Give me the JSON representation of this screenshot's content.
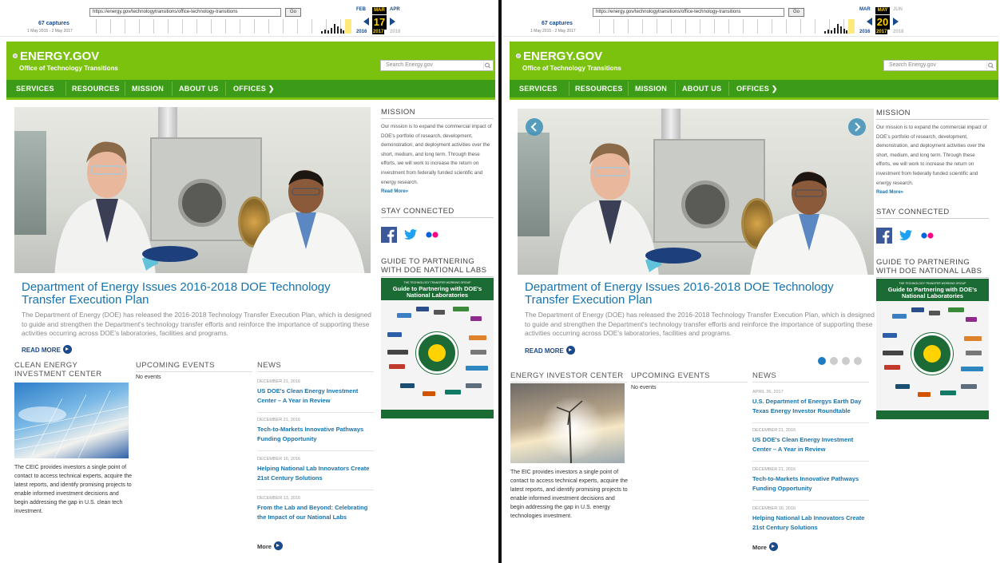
{
  "panels": [
    {
      "wayback": {
        "url": "https://energy.gov/technologytransitions/office-technology-transitions",
        "go": "Go",
        "captures": "67 captures",
        "range": "1 May 2015 - 2 May 2017",
        "prev_month": "FEB",
        "cur_month": "MAR",
        "next_month": "APR",
        "day": "17",
        "prev_year": "2016",
        "cur_year": "2017",
        "next_year": "2018"
      },
      "site": {
        "logo": "ENERGY.GOV",
        "office": "Office of Technology Transitions",
        "search_placeholder": "Search Energy.gov",
        "nav": [
          "SERVICES",
          "RESOURCES",
          "MISSION",
          "ABOUT US",
          "OFFICES ❯"
        ]
      },
      "feature": {
        "title": "Department of Energy Issues 2016-2018 DOE Technology Transfer Execution Plan",
        "body": "The Department of Energy (DOE) has released the 2016-2018 Technology Transfer Execution Plan, which is designed to guide and strengthen the Department's technology transfer efforts and reinforce the importance of supporting these activities occurring across DOE's laboratories, facilities and programs.",
        "read_more": "READ MORE"
      },
      "center": {
        "heading": "CLEAN ENERGY INVESTMENT CENTER",
        "text": "The CEIC provides investors a single point of contact to access technical experts, acquire the latest reports, and identify promising projects to enable informed investment decisions and begin addressing the gap in U.S. clean tech investment."
      },
      "events": {
        "heading": "UPCOMING EVENTS",
        "empty": "No events"
      },
      "news": {
        "heading": "NEWS",
        "items": [
          {
            "date": "DECEMBER 21, 2016",
            "title": "US DOE's Clean Energy Investment Center – A Year in Review"
          },
          {
            "date": "DECEMBER 21, 2016",
            "title": "Tech-to-Markets Innovative Pathways Funding Opportunity"
          },
          {
            "date": "DECEMBER 16, 2016",
            "title": "Helping National Lab Innovators Create 21st Century Solutions"
          },
          {
            "date": "DECEMBER 13, 2016",
            "title": "From the Lab and Beyond: Celebrating the Impact of our National Labs"
          }
        ],
        "more": "More"
      },
      "sidebar": {
        "mission_heading": "MISSION",
        "mission_text": "Our mission is to expand the commercial impact of DOE's portfolio of research, development, demonstration, and deployment activities over the short, medium, and long term. Through these efforts, we will work to increase the return on investment from federally funded scientific and energy research.",
        "read_more": "Read More»",
        "stay_heading": "STAY CONNECTED",
        "guide_heading": "GUIDE TO PARTNERING WITH DOE NATIONAL LABS",
        "guide_image_top": "THE TECHNOLOGY TRANSFER WORKING GROUP",
        "guide_image_title": "Guide to Partnering with DOE's National Laboratories"
      }
    },
    {
      "wayback": {
        "url": "https://energy.gov/technologytransitions/office-technology-transitions",
        "go": "Go",
        "captures": "67 captures",
        "range": "1 May 2015 - 2 May 2017",
        "prev_month": "MAR",
        "cur_month": "MAY",
        "next_month": "JUN",
        "day": "20",
        "prev_year": "2016",
        "cur_year": "2017",
        "next_year": "2018"
      },
      "site": {
        "logo": "ENERGY.GOV",
        "office": "Office of Technology Transitions",
        "search_placeholder": "Search Energy.gov",
        "nav": [
          "SERVICES",
          "RESOURCES",
          "MISSION",
          "ABOUT US",
          "OFFICES ❯"
        ]
      },
      "feature": {
        "title": "Department of Energy Issues 2016-2018 DOE Technology Transfer Execution Plan",
        "body": "The Department of Energy (DOE) has released the 2016-2018 Technology Transfer Execution Plan, which is designed to guide and strengthen the Department's technology transfer efforts and reinforce the importance of supporting these activities occurring across DOE's laboratories, facilities and programs.",
        "read_more": "READ MORE"
      },
      "center": {
        "heading": "ENERGY INVESTOR CENTER",
        "text": "The EIC provides investors a single point of contact to access technical experts, acquire the latest reports, and identify promising projects to enable informed investment decisions and begin addressing the gap in U.S. energy technologies investment."
      },
      "events": {
        "heading": "UPCOMING EVENTS",
        "empty": "No events"
      },
      "news": {
        "heading": "NEWS",
        "items": [
          {
            "date": "APRIL 26, 2017",
            "title": "U.S. Department of Energys Earth Day Texas Energy Investor Roundtable"
          },
          {
            "date": "DECEMBER 21, 2016",
            "title": "US DOE's Clean Energy Investment Center – A Year in Review"
          },
          {
            "date": "DECEMBER 21, 2016",
            "title": "Tech-to-Markets Innovative Pathways Funding Opportunity"
          },
          {
            "date": "DECEMBER 16, 2016",
            "title": "Helping National Lab Innovators Create 21st Century Solutions"
          }
        ],
        "more": "More"
      },
      "sidebar": {
        "mission_heading": "MISSION",
        "mission_text": "Our mission is to expand the commercial impact of DOE's portfolio of research, development, demonstration, and deployment activities over the short, medium, and long term. Through these efforts, we will work to increase the return on investment from federally funded scientific and energy research.",
        "read_more": "Read More»",
        "stay_heading": "STAY CONNECTED",
        "guide_heading": "GUIDE TO PARTNERING WITH DOE NATIONAL LABS",
        "guide_image_top": "THE TECHNOLOGY TRANSFER WORKING GROUP",
        "guide_image_title": "Guide to Partnering with DOE's National Laboratories"
      }
    }
  ],
  "colors": {
    "header_green": "#7bc20f",
    "nav_green": "#3c9c17",
    "link_blue": "#1773ae",
    "dark_blue": "#1a4a8a"
  }
}
